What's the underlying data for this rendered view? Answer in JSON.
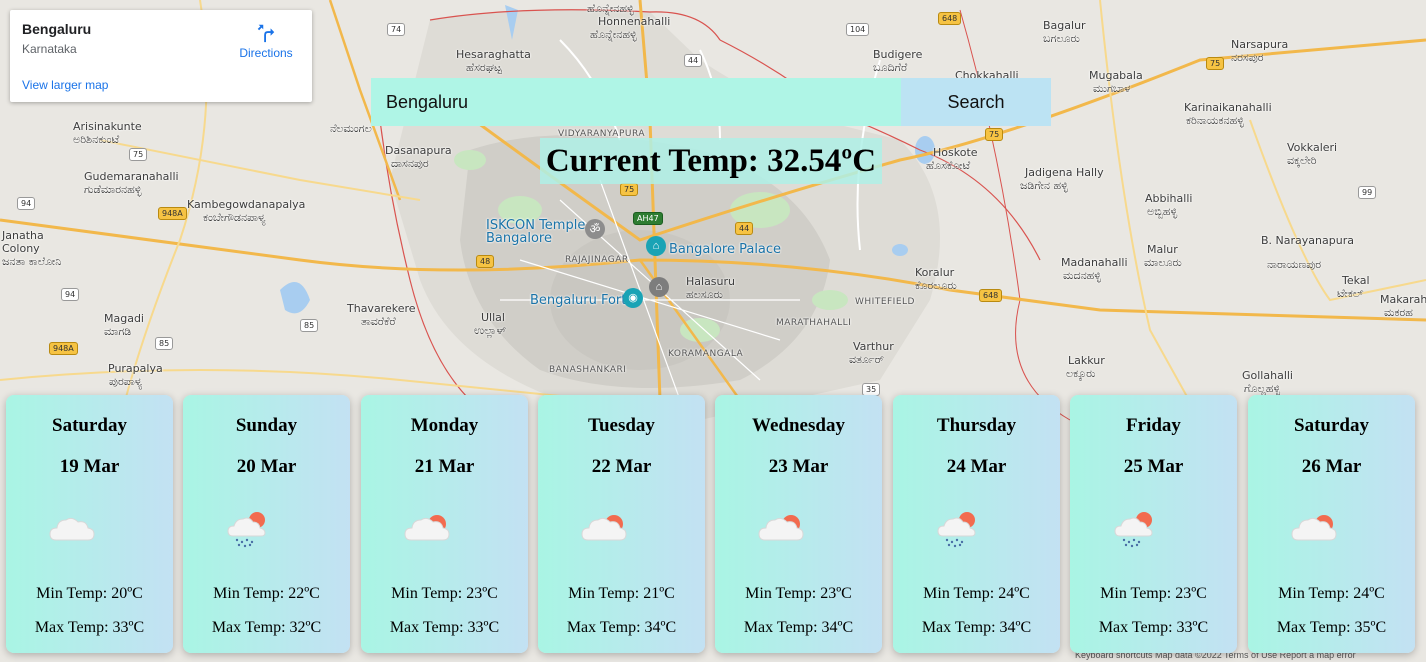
{
  "map": {
    "places": [
      {
        "name": "Honnenahalli",
        "name_kn": "ಹೊನ್ನೇನಹಳ್ಳಿ"
      },
      {
        "name": "Hesaraghatta",
        "name_kn": "ಹೆಸರಘಟ್ಟ"
      },
      {
        "name": "Budigere",
        "name_kn": "ಬೂದಿಗೆರೆ"
      },
      {
        "name": "Bagalur",
        "name_kn": "ಬಗಲೂರು"
      },
      {
        "name": "Narsapura",
        "name_kn": "ನರಸಪುರ"
      },
      {
        "name": "Chokkahalli"
      },
      {
        "name": "Mugabala",
        "name_kn": "ಮುಗಬಾಳ"
      },
      {
        "name": "Karinaikanahalli",
        "name_kn": "ಕರಿನಾಯಕನಹಳ್ಳಿ"
      },
      {
        "name": "Arisinakunte",
        "name_kn": "ಅರಿಶಿನಕುಂಟೆ"
      },
      {
        "name": "Nelamangala Town",
        "name_kn": "ನೆಲಮಂಗಲ"
      },
      {
        "name": "Dasanapura",
        "name_kn": "ದಾಸನಪುರ"
      },
      {
        "name": "Hoskote",
        "name_kn": "ಹೊಸಕೋಟೆ"
      },
      {
        "name": "Vokkaleri",
        "name_kn": "ವಕ್ಕಲೇರಿ"
      },
      {
        "name": "Gudemaranahalli",
        "name_kn": "ಗುಡೆಮಾರನಹಳ್ಳಿ"
      },
      {
        "name": "Kambegowdanapalya",
        "name_kn": "ಕಂಬೇಗೌಡನಪಾಳ್ಯ"
      },
      {
        "name": "Jadigena Hally",
        "name_kn": "ಜಡಿಗೇನ ಹಳ್ಳಿ"
      },
      {
        "name": "Abbihalli",
        "name_kn": "ಅಬ್ಬಿಹಳ್ಳಿ"
      },
      {
        "name": "Janatha Colony",
        "name_kn": "ಜನತಾ ಕಾಲೋನಿ"
      },
      {
        "name": "Malur",
        "name_kn": "ಮಾಲೂರು"
      },
      {
        "name": "B. Narayanapura",
        "name_kn": "ನಾರಾಯಣಪುರ"
      },
      {
        "name": "Madanahalli",
        "name_kn": "ಮದನಹಳ್ಳಿ"
      },
      {
        "name": "Koralur",
        "name_kn": "ಕೊರಲೂರು"
      },
      {
        "name": "Tekal",
        "name_kn": "ಟೇಕಲ್"
      },
      {
        "name": "Makarah",
        "name_kn": "ಮಕರಹ"
      },
      {
        "name": "Thavarekere",
        "name_kn": "ತಾವರೆಕೆರೆ"
      },
      {
        "name": "Ullal",
        "name_kn": "ಉಲ್ಲಾಳ್"
      },
      {
        "name": "Halasuru",
        "name_kn": "ಹಲಸೂರು"
      },
      {
        "name": "Magadi",
        "name_kn": "ಮಾಗಡಿ"
      },
      {
        "name": "Varthur",
        "name_kn": "ವರ್ತೂರ್"
      },
      {
        "name": "Purapalya",
        "name_kn": "ಪುರಪಾಳ್ಯ"
      },
      {
        "name": "Lakkur",
        "name_kn": "ಲಕ್ಕೂರು"
      },
      {
        "name": "Gollahalli",
        "name_kn": "ಗೊಲ್ಲಹಳ್ಳಿ"
      }
    ],
    "districts": [
      "VIDYARANYAPURA",
      "RAJAJINAGAR",
      "WHITEFIELD",
      "MARATHAHALLI",
      "KORAMANGALA",
      "BANASHANKARI"
    ],
    "pois": [
      "ISKCON Temple Bangalore",
      "Bangalore Palace",
      "Bengaluru Fort"
    ],
    "shields": [
      "74",
      "104",
      "648",
      "44",
      "75",
      "94",
      "948A",
      "48",
      "AH47",
      "85",
      "99",
      "35"
    ],
    "footer": "Keyboard shortcuts   Map data ©2022   Terms of Use   Report a map error"
  },
  "info_card": {
    "title": "Bengaluru",
    "subtitle": "Karnataka",
    "directions_label": "Directions",
    "larger_map_link": "View larger map"
  },
  "search": {
    "value": "Bengaluru",
    "button_label": "Search"
  },
  "current_temp": "Current Temp: 32.54ºC",
  "forecast": [
    {
      "day": "Saturday",
      "date": "19 Mar",
      "icon": "cloud-icon",
      "min": "Min Temp: 20ºC",
      "max": "Max Temp: 33ºC"
    },
    {
      "day": "Sunday",
      "date": "20 Mar",
      "icon": "rain-sun-icon",
      "min": "Min Temp: 22ºC",
      "max": "Max Temp: 32ºC"
    },
    {
      "day": "Monday",
      "date": "21 Mar",
      "icon": "partly-cloudy-icon",
      "min": "Min Temp: 23ºC",
      "max": "Max Temp: 33ºC"
    },
    {
      "day": "Tuesday",
      "date": "22 Mar",
      "icon": "partly-cloudy-icon",
      "min": "Min Temp: 21ºC",
      "max": "Max Temp: 34ºC"
    },
    {
      "day": "Wednesday",
      "date": "23 Mar",
      "icon": "partly-cloudy-icon",
      "min": "Min Temp: 23ºC",
      "max": "Max Temp: 34ºC"
    },
    {
      "day": "Thursday",
      "date": "24 Mar",
      "icon": "rain-sun-icon",
      "min": "Min Temp: 24ºC",
      "max": "Max Temp: 34ºC"
    },
    {
      "day": "Friday",
      "date": "25 Mar",
      "icon": "rain-sun-icon",
      "min": "Min Temp: 23ºC",
      "max": "Max Temp: 33ºC"
    },
    {
      "day": "Saturday",
      "date": "26 Mar",
      "icon": "partly-cloudy-icon",
      "min": "Min Temp: 24ºC",
      "max": "Max Temp: 35ºC"
    }
  ],
  "colors": {
    "search_input_bg": "#aff5e6",
    "search_button_bg": "#bce3f3",
    "card_gradient_start": "#a9f5e4",
    "card_gradient_end": "#c3e1f3",
    "map_link": "#1a73e8"
  }
}
